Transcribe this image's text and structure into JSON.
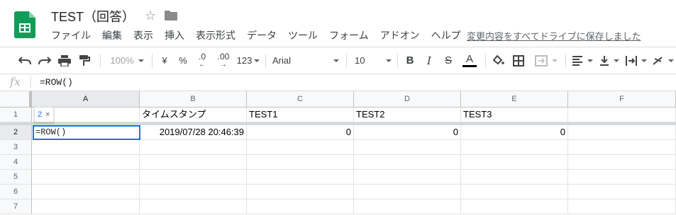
{
  "header": {
    "title": "TEST（回答）",
    "menus": [
      "ファイル",
      "編集",
      "表示",
      "挿入",
      "表示形式",
      "データ",
      "ツール",
      "フォーム",
      "アドオン",
      "ヘルプ"
    ],
    "save_status": "変更内容をすべてドライブに保存しました"
  },
  "toolbar": {
    "zoom": "100%",
    "currency": "¥",
    "percent": "%",
    "decimal_decrease": ".0",
    "decimal_increase": ".00",
    "number_format": "123",
    "font": "Arial",
    "font_size": "10",
    "bold": "B",
    "italic": "I",
    "strike": "S",
    "text_color_letter": "A"
  },
  "formula_bar": {
    "fx": "fx",
    "value": "=ROW()"
  },
  "sheet": {
    "columns": [
      "A",
      "B",
      "C",
      "D",
      "E",
      "F"
    ],
    "rows": [
      "1",
      "2",
      "3",
      "4",
      "5",
      "6",
      "7"
    ],
    "row1": [
      "",
      "タイムスタンプ",
      "TEST1",
      "TEST2",
      "TEST3",
      ""
    ],
    "row2": [
      "=ROW()",
      "2019/07/28 20:46:39",
      "0",
      "0",
      "0",
      ""
    ],
    "active_cell_value": "=ROW()",
    "tooltip_value": "2",
    "tooltip_close": "×"
  },
  "colors": {
    "accent": "#1a73e8",
    "logo_green": "#0f9d58"
  }
}
